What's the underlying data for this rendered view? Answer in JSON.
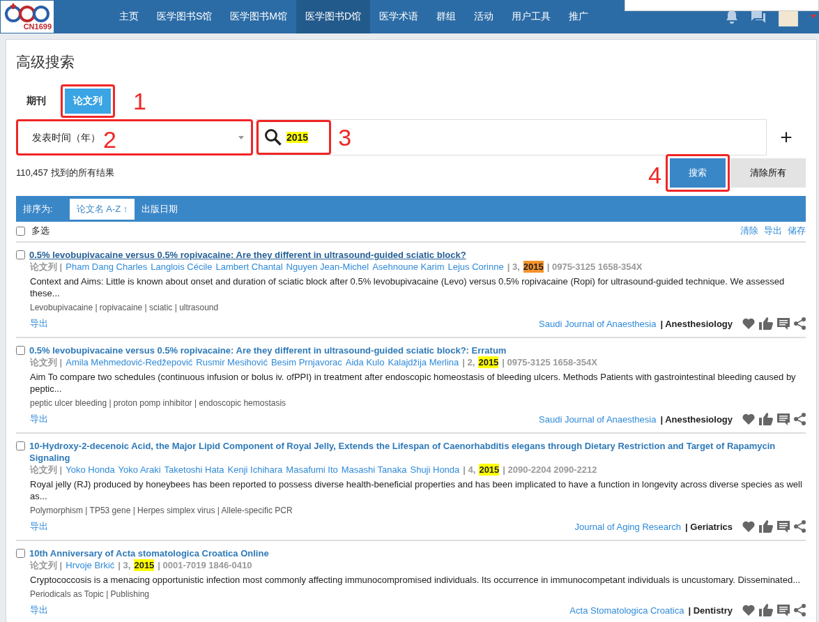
{
  "nav": {
    "logo_text": "CN1699",
    "items": [
      {
        "label": "主页",
        "selected": false
      },
      {
        "label": "医学图书S馆",
        "selected": false
      },
      {
        "label": "医学图书M馆",
        "selected": false
      },
      {
        "label": "医学图书D馆",
        "selected": true
      },
      {
        "label": "医学术语",
        "selected": false
      },
      {
        "label": "群组",
        "selected": false
      },
      {
        "label": "活动",
        "selected": false
      },
      {
        "label": "用户工具",
        "selected": false
      },
      {
        "label": "推广",
        "selected": false
      }
    ]
  },
  "page_title": "高级搜索",
  "tabs": [
    {
      "label": "期刊",
      "selected": false
    },
    {
      "label": "论文列",
      "selected": true,
      "annotation": "1"
    }
  ],
  "field_select": {
    "value": "发表时间（年）",
    "annotation": "2"
  },
  "search": {
    "value": "2015",
    "annotation": "3",
    "add_label": "+"
  },
  "result_count": "110,457 找到的所有结果",
  "buttons": {
    "search": "搜索",
    "search_annotation": "4",
    "clear": "清除所有"
  },
  "sort": {
    "label": "排序为:",
    "options": [
      {
        "label": "论文名 A-Z ↑",
        "selected": true
      },
      {
        "label": "出版日期",
        "selected": false
      }
    ]
  },
  "select_all": {
    "label": "多选",
    "checked": false
  },
  "list_actions": [
    "清除",
    "导出",
    "储存"
  ],
  "results": [
    {
      "focused": true,
      "checked": false,
      "title": "0.5% levobupivacaine versus 0.5% ropivacaine: Are they different in ultrasound-guided sciatic block?",
      "type_label": "论文列 |",
      "authors": [
        "Pham Dang Charles",
        "Langlois Cécile",
        "Lambert Chantal",
        "Nguyen Jean-Michel",
        "Asehnoune Karim",
        "Lejus Corinne"
      ],
      "issue": "| 3,",
      "year": "2015",
      "issn": "| 0975-3125 1658-354X",
      "abstract": "Context and Aims: Little is known about onset and duration of sciatic block after 0.5% levobupivacaine (Levo) versus 0.5% ropivacaine (Ropi) for ultrasound-guided technique. We assessed these...",
      "keywords": "Levobupivacaine | ropivacaine | sciatic | ultrasound",
      "export": "导出",
      "journal": "Saudi Journal of Anaesthesia",
      "category": "| Anesthesiology"
    },
    {
      "focused": false,
      "checked": false,
      "title": "0.5% levobupivacaine versus 0.5% ropivacaine: Are they different in ultrasound-guided sciatic block?: Erratum",
      "type_label": "论文列 |",
      "authors": [
        "Amila Mehmedović-Redžepović",
        "Rusmir Mesihović",
        "Besim Prnjavorac",
        "Aida Kulo",
        "Kalajdžija Merlina"
      ],
      "issue": "| 2,",
      "year": "2015",
      "issn": "| 0975-3125 1658-354X",
      "abstract": "Aim To compare two schedules (continuous infusion or bolus iv. ofPPI) in treatment after endoscopic homeostasis of bleeding ulcers. Methods Patients with gastrointestinal bleeding caused by peptic...",
      "keywords": "peptic ulcer bleeding | proton pomp inhibitor | endoscopic hemostasis",
      "export": "导出",
      "journal": "Saudi Journal of Anaesthesia",
      "category": "| Anesthesiology"
    },
    {
      "focused": false,
      "checked": false,
      "title": "10-Hydroxy-2-decenoic Acid, the Major Lipid Component of Royal Jelly, Extends the Lifespan of Caenorhabditis elegans through Dietary Restriction and Target of Rapamycin Signaling",
      "type_label": "论文列 |",
      "authors": [
        "Yoko Honda",
        "Yoko Araki",
        "Taketoshi Hata",
        "Kenji Ichihara",
        "Masafumi Ito",
        "Masashi Tanaka",
        "Shuji Honda"
      ],
      "issue": "| 4,",
      "year": "2015",
      "issn": "| 2090-2204 2090-2212",
      "abstract": "Royal jelly (RJ) produced by honeybees has been reported to possess diverse health-beneficial properties and has been implicated to have a function in longevity across diverse species as well as...",
      "keywords": "Polymorphism | TP53 gene | Herpes simplex virus | Allele-specific PCR",
      "export": "导出",
      "journal": "Journal of Aging Research",
      "category": "| Geriatrics"
    },
    {
      "focused": false,
      "checked": false,
      "title": "10th Anniversary of Acta stomatologica Croatica Online",
      "type_label": "论文列 |",
      "authors": [
        "Hrvoje Brkić"
      ],
      "issue": "| 3,",
      "year": "2015",
      "issn": "| 0001-7019 1846-0410",
      "abstract": "Cryptococcosis is a menacing opportunistic infection most commonly affecting immunocompromised individuals. Its occurrence in immunocompetant individuals is uncustomary. Disseminated...",
      "keywords": "Periodicals as Topic | Publishing",
      "export": "导出",
      "journal": "Acta Stomatologica Croatica",
      "category": "| Dentistry"
    }
  ]
}
